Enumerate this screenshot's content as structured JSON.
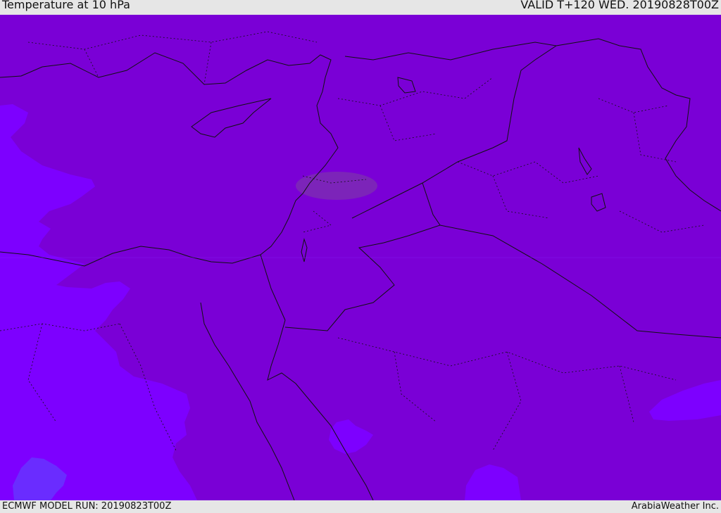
{
  "header": {
    "title": "Temperature at 10 hPa",
    "valid": "VALID T+120 WED. 20190828T00Z"
  },
  "footer": {
    "model_run": "ECMWF MODEL RUN: 20190823T00Z",
    "credit": "ArabiaWeather Inc."
  },
  "map": {
    "variable": "temperature",
    "level_hPa": 10,
    "colors": {
      "field_main": "#7a00d6",
      "field_cool": "#7d00ff",
      "field_coolest": "#6a2cff",
      "field_warm_patch": "#7c2ab4",
      "borders": "#111111"
    }
  }
}
